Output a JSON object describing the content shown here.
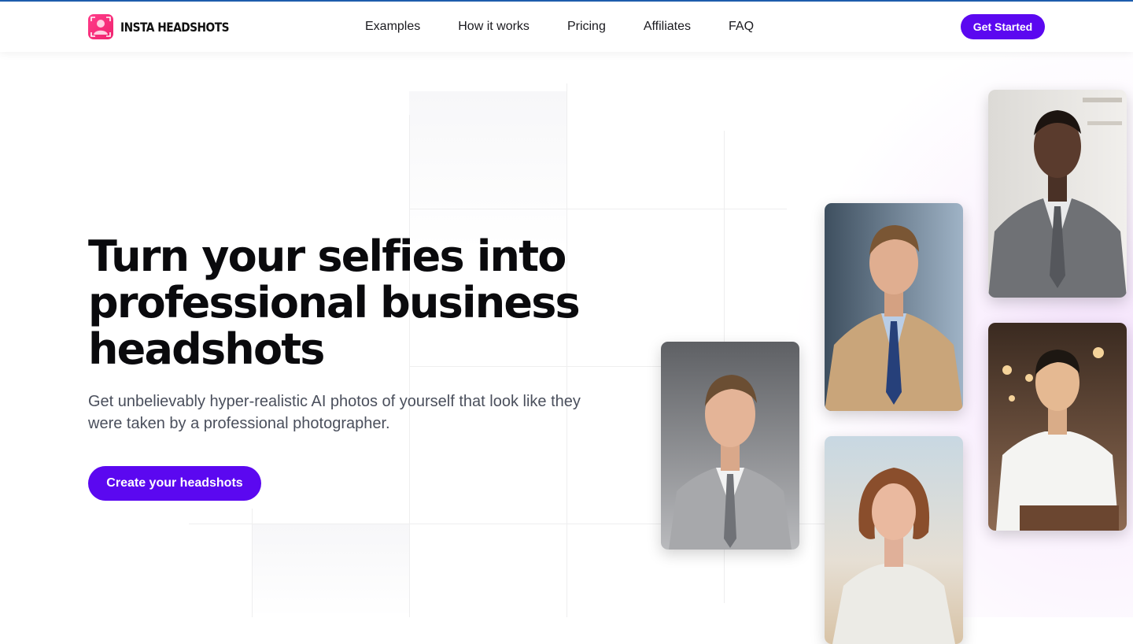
{
  "brand": {
    "name": "INSTA HEADSHOTS",
    "logo_icon": "person-portrait-icon",
    "accent": "#5b08f0",
    "logo_color": "#f0236f"
  },
  "nav": {
    "items": [
      {
        "label": "Examples"
      },
      {
        "label": "How it works"
      },
      {
        "label": "Pricing"
      },
      {
        "label": "Affiliates"
      },
      {
        "label": "FAQ"
      }
    ],
    "cta_label": "Get Started"
  },
  "hero": {
    "title": "Turn your selfies into professional business headshots",
    "subtitle": "Get unbelievably hyper-realistic AI photos of yourself that look like they were taken by a professional photographer.",
    "cta_label": "Create your headshots"
  },
  "photos": [
    {
      "name": "headshot-man-grey-suit"
    },
    {
      "name": "headshot-man-tan-blazer"
    },
    {
      "name": "headshot-woman-beach"
    },
    {
      "name": "headshot-man-office"
    },
    {
      "name": "headshot-man-cafe"
    }
  ]
}
